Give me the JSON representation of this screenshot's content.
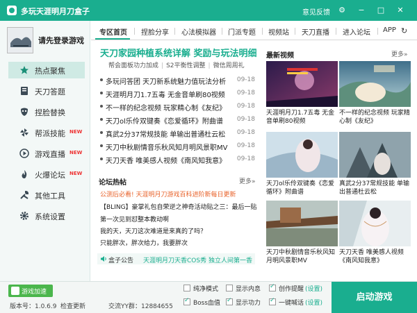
{
  "window": {
    "title": "多玩天涯明月刀盒子",
    "feedback": "意见反馈",
    "buttons": [
      "settings",
      "minimize",
      "close"
    ]
  },
  "sidebar": {
    "login": "请先登录游戏",
    "items": [
      {
        "label": "热点聚焦",
        "icon": "star-icon",
        "active": true,
        "badge": ""
      },
      {
        "label": "天刀答题",
        "icon": "book-icon",
        "active": false,
        "badge": ""
      },
      {
        "label": "捏脸替换",
        "icon": "mask-icon",
        "active": false,
        "badge": ""
      },
      {
        "label": "帮派技能",
        "icon": "pinwheel-icon",
        "active": false,
        "badge": "NEW"
      },
      {
        "label": "游戏直播",
        "icon": "play-icon",
        "active": false,
        "badge": "NEW"
      },
      {
        "label": "火爆论坛",
        "icon": "chat-icon",
        "active": false,
        "badge": "NEW"
      },
      {
        "label": "其他工具",
        "icon": "tools-icon",
        "active": false,
        "badge": ""
      },
      {
        "label": "系统设置",
        "icon": "gear-icon",
        "active": false,
        "badge": ""
      }
    ]
  },
  "tabs": [
    "专区首页",
    "捏脸分享",
    "心法模拟器",
    "门派专题",
    "视频站",
    "天刀直播",
    "进入论坛",
    "APP"
  ],
  "main": {
    "headline": "天刀家园种植系统详解 奖励与玩法明细",
    "sub_links": [
      "帮会面板功力加成",
      "S2平衡性调整",
      "微信周周礼"
    ],
    "news": [
      {
        "title": "多玩问答团 天刀新系统魅力值玩法分析",
        "date": "09-18"
      },
      {
        "title": "天涯明月刀1.7五毒 无金音单刷80视频",
        "date": "09-18"
      },
      {
        "title": "不一样的纪念视频 玩家精心制《友纪》",
        "date": "09-18"
      },
      {
        "title": "天刀ol乐伶双键奏《恋爱循环》附曲谱",
        "date": "09-18"
      },
      {
        "title": "真武2分37常规技能 单输出普通杜云松",
        "date": "09-18"
      },
      {
        "title": "天刀中秋剧情音乐秋风知月明风景职MV",
        "date": "09-18"
      },
      {
        "title": "天刀天香 唯美感人视频《南风知我意》",
        "date": "09-18"
      }
    ],
    "forum_title": "论坛热帖",
    "forum_more": "更多»",
    "forum": [
      {
        "title": "公测后必看! 天涯明月刀游戏百科进阶新每日更新",
        "hot": true
      },
      {
        "title": "【BLING】豪掌礼包自荣逆之神奇活动贴之三：最后一贴",
        "hot": false
      },
      {
        "title": "第一次见到怼整本教动啊",
        "hot": false
      },
      {
        "title": "我的天，天刀这次难道是来真的了吗？",
        "hot": false
      },
      {
        "title": "只能胖次，胖次给力，我要胖次",
        "hot": false
      }
    ],
    "notice_label": "盒子公告",
    "notice_text": "天涯明月刀天香COS秀 独立人间第一香"
  },
  "videos": {
    "title": "最新视频",
    "more": "更多»",
    "items": [
      {
        "caption": "天涯明月刀1.7五毒 无金音单刷80视频"
      },
      {
        "caption": "不一样的纪念视频 玩家精心制《友纪》"
      },
      {
        "caption": "天刀ol乐伶双键奏《恋爱循环》附曲谱"
      },
      {
        "caption": "真武2分37常规技能 单输出普通杜云松"
      },
      {
        "caption": "天刀中秋剧情音乐秋风知月明风景职MV"
      },
      {
        "caption": "天刀天香 唯美感人视频《南风知我意》"
      }
    ]
  },
  "bottom": {
    "accel": "游戏加速",
    "version": "版本号：1.0.6.9",
    "check_update": "检查更新",
    "qq_group": "交流YY群：12884655",
    "options": [
      {
        "label": "纯净模式",
        "checked": false,
        "extra": ""
      },
      {
        "label": "显示内息",
        "checked": false,
        "extra": ""
      },
      {
        "label": "创作提醒",
        "checked": true,
        "extra": "(设置)"
      },
      {
        "label": "Boss血值",
        "checked": true,
        "extra": ""
      },
      {
        "label": "显示功力",
        "checked": true,
        "extra": ""
      },
      {
        "label": "一键喊话",
        "checked": true,
        "extra": "(设置)"
      }
    ],
    "start": "启动游戏"
  },
  "colors": {
    "accent": "#1aae8f",
    "hot": "#e8622a",
    "new_badge": "#e33333",
    "accel": "#4bb64c"
  }
}
